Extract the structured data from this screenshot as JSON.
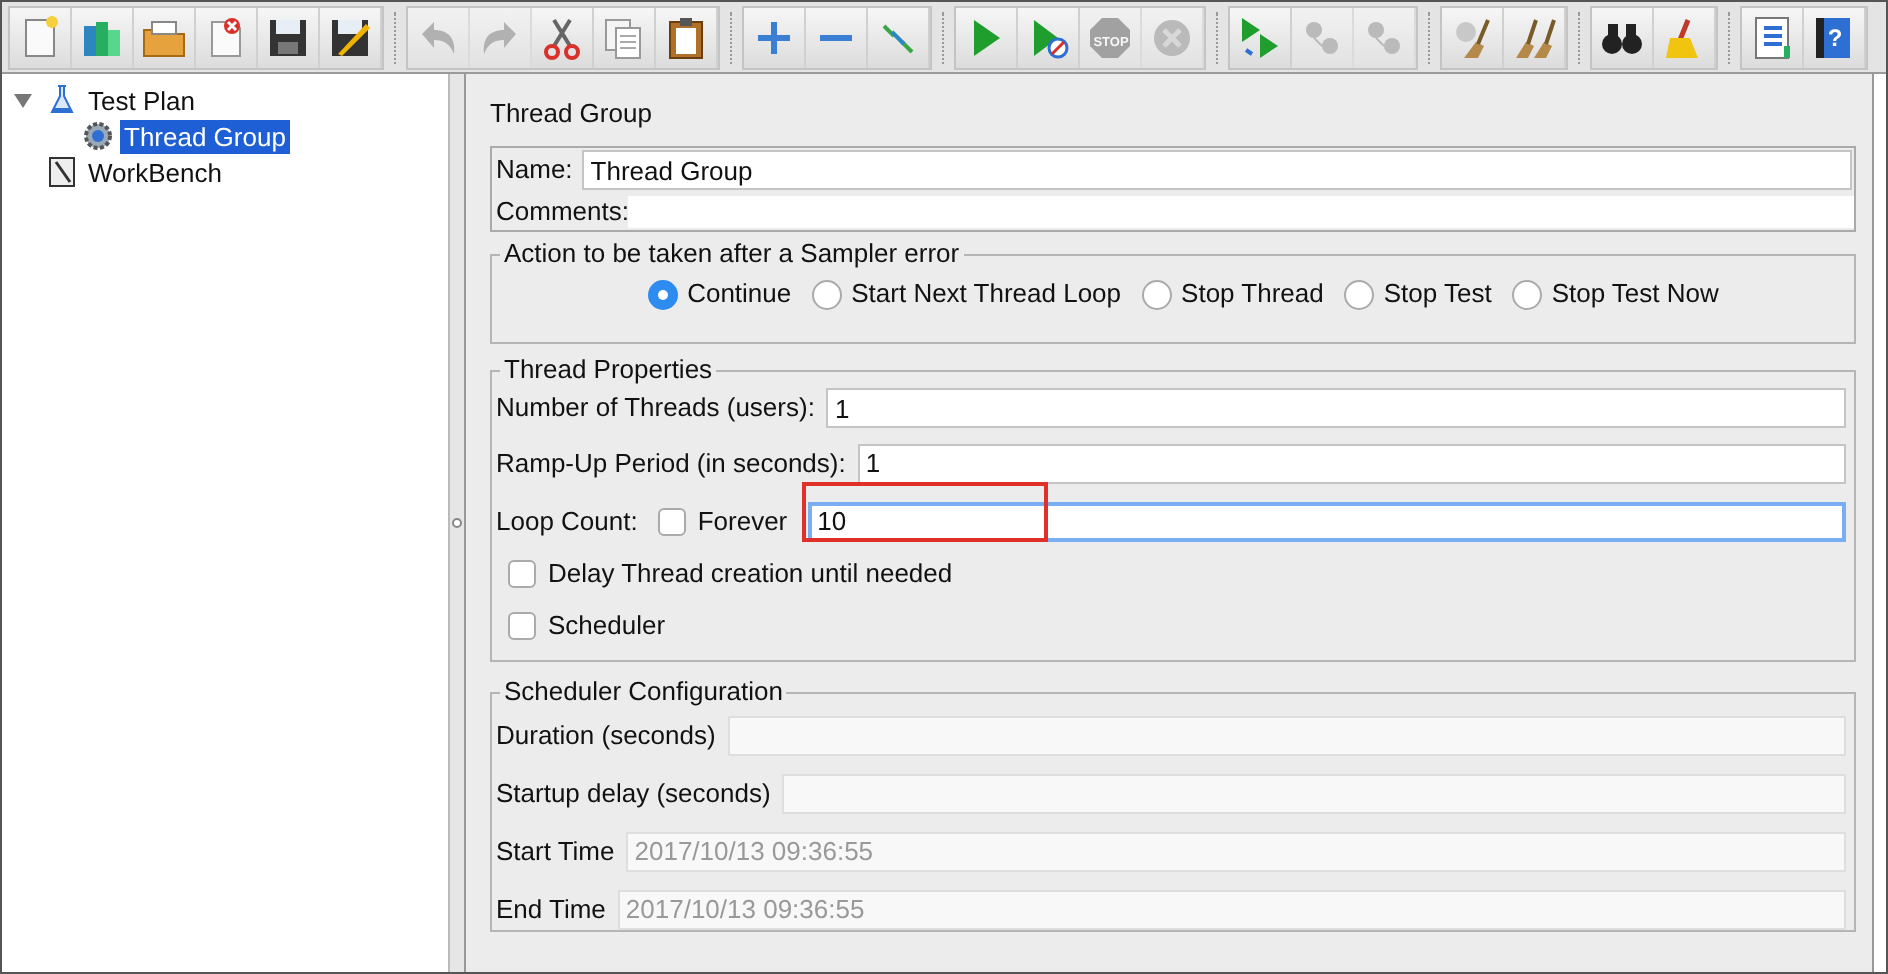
{
  "toolbar": {
    "groups": [
      [
        {
          "disabled": false
        },
        {
          "disabled": false
        },
        {
          "disabled": false
        },
        {
          "disabled": false
        },
        {
          "disabled": false
        },
        {
          "disabled": false
        }
      ],
      [
        {
          "disabled": true
        },
        {
          "disabled": true
        },
        {
          "disabled": false
        },
        {
          "disabled": false
        },
        {
          "disabled": false
        }
      ],
      [
        {
          "disabled": false
        },
        {
          "disabled": false
        },
        {
          "disabled": false
        }
      ],
      [
        {
          "disabled": false
        },
        {
          "disabled": false
        },
        {
          "disabled": true,
          "label": "STOP"
        },
        {
          "disabled": true
        }
      ],
      [
        {
          "disabled": false
        },
        {
          "disabled": true
        },
        {
          "disabled": true
        }
      ],
      [
        {
          "disabled": false
        },
        {
          "disabled": false
        }
      ],
      [
        {
          "disabled": false
        },
        {
          "disabled": false
        }
      ],
      [
        {
          "disabled": false
        },
        {
          "disabled": false,
          "label": "?"
        }
      ]
    ]
  },
  "tree": [
    {
      "label": "Test Plan",
      "kind": "plan",
      "expanded": true,
      "selected": false,
      "children": [
        {
          "label": "Thread Group",
          "kind": "group",
          "selected": true
        }
      ]
    },
    {
      "label": "WorkBench",
      "kind": "workbench",
      "selected": false
    }
  ],
  "panel": {
    "title": "Thread Group",
    "name": {
      "label": "Name:",
      "value": "Thread Group"
    },
    "comments": {
      "label": "Comments:"
    },
    "sampler_error": {
      "legend": "Action to be taken after a Sampler error",
      "options": [
        {
          "label": "Continue",
          "selected": true
        },
        {
          "label": "Start Next Thread Loop",
          "selected": false
        },
        {
          "label": "Stop Thread",
          "selected": false
        },
        {
          "label": "Stop Test",
          "selected": false
        },
        {
          "label": "Stop Test Now",
          "selected": false
        }
      ]
    },
    "thread_properties": {
      "legend": "Thread Properties",
      "threads": {
        "label": "Number of Threads (users):",
        "value": "1"
      },
      "ramp_up": {
        "label": "Ramp-Up Period (in seconds):",
        "value": "1"
      },
      "loop_count": {
        "label": "Loop Count:",
        "forever": {
          "label": "Forever",
          "checked": false
        },
        "value": "10",
        "focused": true,
        "highlighted": true
      },
      "options": [
        {
          "label": "Delay Thread creation until needed",
          "checked": false
        },
        {
          "label": "Scheduler",
          "checked": false
        }
      ]
    },
    "scheduler": {
      "legend": "Scheduler Configuration",
      "fields": [
        {
          "label": "Duration (seconds)",
          "disabled": true
        },
        {
          "label": "Startup delay (seconds)",
          "disabled": true
        },
        {
          "label": "Start Time",
          "value": "2017/10/13 09:36:55",
          "disabled": true
        },
        {
          "label": "End Time",
          "value": "2017/10/13 09:36:55",
          "disabled": true
        }
      ]
    }
  }
}
